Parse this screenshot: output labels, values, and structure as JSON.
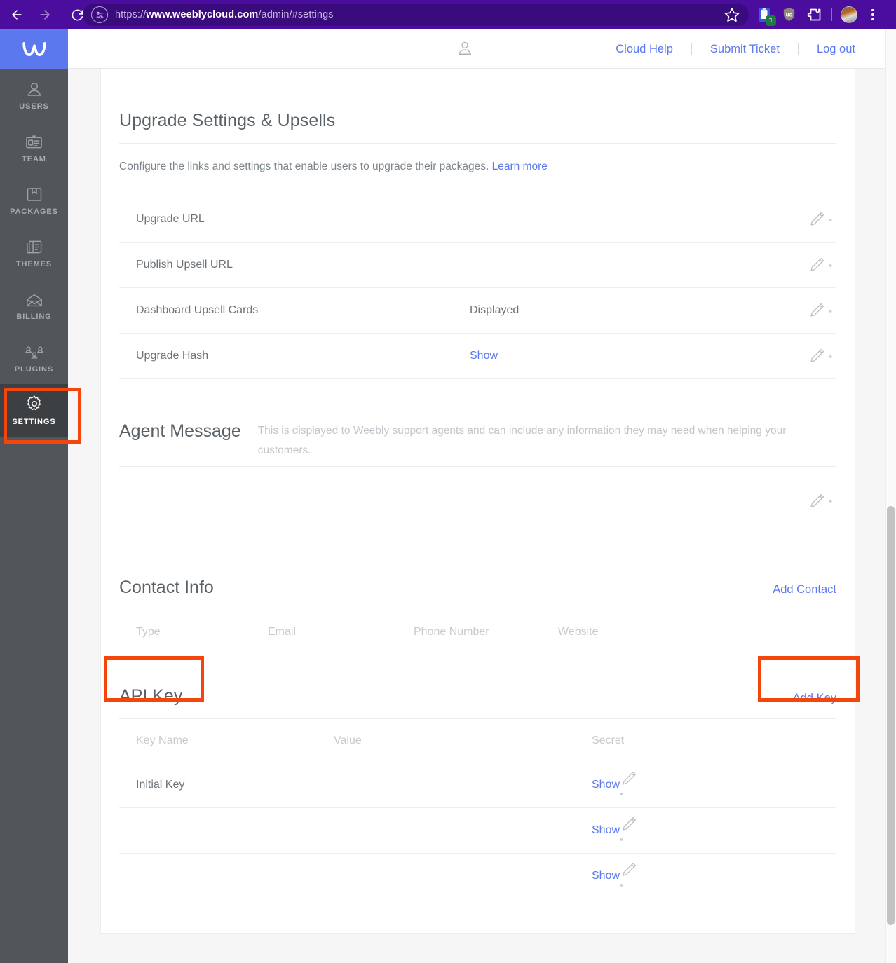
{
  "browser": {
    "url_scheme": "https://",
    "url_domain": "www.weeblycloud.com",
    "url_path": "/admin/#settings",
    "back_icon": "back-arrow-icon",
    "forward_icon": "forward-arrow-icon",
    "reload_icon": "reload-icon",
    "site_info_icon": "site-settings-icon",
    "bookmark_icon": "star-icon",
    "extension_badge_count": "1",
    "menu_icon": "kebab-menu-icon"
  },
  "sidebar": {
    "logo": "weebly-logo",
    "items": [
      {
        "label": "USERS",
        "icon": "user-icon",
        "active": false
      },
      {
        "label": "TEAM",
        "icon": "id-card-icon",
        "active": false
      },
      {
        "label": "PACKAGES",
        "icon": "box-icon",
        "active": false
      },
      {
        "label": "THEMES",
        "icon": "layout-icon",
        "active": false
      },
      {
        "label": "BILLING",
        "icon": "envelope-icon",
        "active": false
      },
      {
        "label": "PLUGINS",
        "icon": "network-icon",
        "active": false
      },
      {
        "label": "SETTINGS",
        "icon": "gear-icon",
        "active": true
      }
    ]
  },
  "topbar": {
    "user_icon": "user-avatar-icon",
    "links": [
      "Cloud Help",
      "Submit Ticket",
      "Log out"
    ]
  },
  "upgrade": {
    "title": "Upgrade Settings & Upsells",
    "description": "Configure the links and settings that enable users to upgrade their packages.",
    "learn_more": "Learn more",
    "rows": [
      {
        "label": "Upgrade URL",
        "value": "",
        "value_is_link": false
      },
      {
        "label": "Publish Upsell URL",
        "value": "",
        "value_is_link": false
      },
      {
        "label": "Dashboard Upsell Cards",
        "value": "Displayed",
        "value_is_link": false
      },
      {
        "label": "Upgrade Hash",
        "value": "Show",
        "value_is_link": true
      }
    ]
  },
  "agent_message": {
    "title": "Agent Message",
    "description": "This is displayed to Weebly support agents and can include any information they may need when helping your customers.",
    "body": ""
  },
  "contact_info": {
    "title": "Contact Info",
    "add_label": "Add Contact",
    "columns": [
      "Type",
      "Email",
      "Phone Number",
      "Website"
    ],
    "rows": []
  },
  "api_key": {
    "title": "API Key",
    "add_label": "Add Key",
    "columns": [
      "Key Name",
      "Value",
      "Secret"
    ],
    "rows": [
      {
        "key_name": "Initial Key",
        "value": "",
        "secret": "Show"
      },
      {
        "key_name": "",
        "value": "",
        "secret": "Show"
      },
      {
        "key_name": "",
        "value": "",
        "secret": "Show"
      }
    ]
  },
  "colors": {
    "browser_chrome": "#4b0d9e",
    "sidebar": "#52565a",
    "sidebar_active": "#3c4043",
    "brand_blue": "#5b78ef",
    "link_blue": "#5b79f0",
    "highlight_red": "#f4450c"
  },
  "annotations": [
    {
      "name": "settings-nav-highlight"
    },
    {
      "name": "api-key-title-highlight"
    },
    {
      "name": "add-key-highlight"
    }
  ]
}
